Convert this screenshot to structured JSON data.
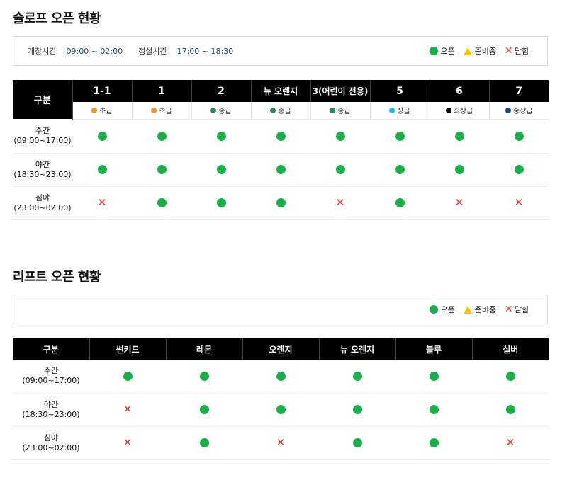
{
  "slope": {
    "title": "슬로프 오픈 현황",
    "hours": [
      {
        "label": "개장시간",
        "value": "09:00 ~ 02:00"
      },
      {
        "label": "정설시간",
        "value": "17:00 ~ 18:30"
      }
    ],
    "legend": {
      "open": "오픈",
      "preparing": "준비중",
      "closed": "닫힘"
    },
    "header_first": "구분",
    "columns": [
      {
        "name": "1-1",
        "level": "초급",
        "color": "#f0923a"
      },
      {
        "name": "1",
        "level": "초급",
        "color": "#f0923a"
      },
      {
        "name": "2",
        "level": "중급",
        "color": "#2e8b57"
      },
      {
        "name": "뉴 오렌지",
        "level": "중급",
        "color": "#2e8b57"
      },
      {
        "name": "3(어린이 전용)",
        "level": "중급",
        "color": "#2e8b57"
      },
      {
        "name": "5",
        "level": "상급",
        "color": "#29b6f6"
      },
      {
        "name": "6",
        "level": "최상급",
        "color": "#000000"
      },
      {
        "name": "7",
        "level": "중상급",
        "color": "#0d47a1"
      }
    ],
    "rows": [
      {
        "label1": "주간",
        "label2": "(09:00~17:00)",
        "status": [
          "open",
          "open",
          "open",
          "open",
          "open",
          "open",
          "open",
          "open"
        ]
      },
      {
        "label1": "야간",
        "label2": "(18:30~23:00)",
        "status": [
          "open",
          "open",
          "open",
          "open",
          "open",
          "open",
          "open",
          "open"
        ]
      },
      {
        "label1": "심야",
        "label2": "(23:00~02:00)",
        "status": [
          "closed",
          "open",
          "open",
          "open",
          "closed",
          "open",
          "closed",
          "closed"
        ]
      }
    ]
  },
  "lift": {
    "title": "리프트 오픈 현황",
    "legend": {
      "open": "오픈",
      "preparing": "준비중",
      "closed": "닫힘"
    },
    "header_first": "구분",
    "columns": [
      "썬키드",
      "레몬",
      "오렌지",
      "뉴 오렌지",
      "블루",
      "실버"
    ],
    "rows": [
      {
        "label1": "주간",
        "label2": "(09:00~17:00)",
        "status": [
          "open",
          "open",
          "open",
          "open",
          "open",
          "open"
        ]
      },
      {
        "label1": "야간",
        "label2": "(18:30~23:00)",
        "status": [
          "closed",
          "open",
          "open",
          "open",
          "open",
          "open"
        ]
      },
      {
        "label1": "심야",
        "label2": "(23:00~02:00)",
        "status": [
          "closed",
          "open",
          "closed",
          "open",
          "open",
          "closed"
        ]
      }
    ]
  },
  "colors": {
    "open": "#1aaf4b",
    "preparing": "#f4c20d",
    "closed": "#e53935"
  },
  "icons": {
    "open": "green-circle",
    "preparing": "yellow-triangle",
    "closed": "red-x"
  }
}
